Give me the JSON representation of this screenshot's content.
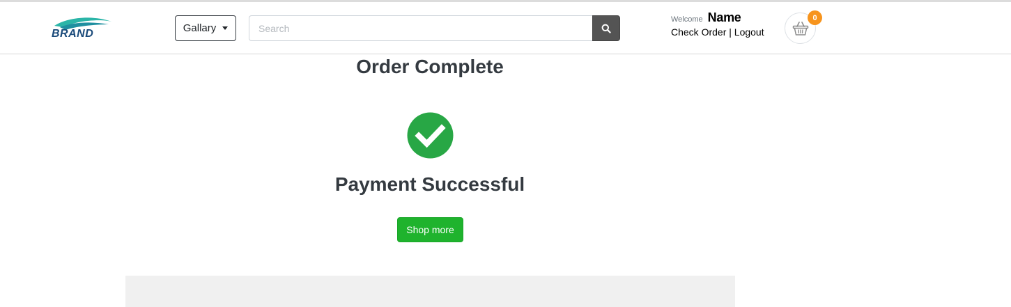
{
  "header": {
    "logo_text": "BRAND",
    "category_dropdown": "Gallary",
    "search": {
      "placeholder": "Search",
      "value": ""
    },
    "welcome_label": "Welcome",
    "user_name": "Name",
    "check_order_link": "Check Order",
    "separator": "|",
    "logout_link": "Logout",
    "cart_count": "0",
    "icons": [
      "search-icon",
      "basket-icon",
      "chevron-down-icon"
    ]
  },
  "main": {
    "title": "Order Complete",
    "status_icon": "check-circle-icon",
    "status_message": "Payment Successful",
    "shop_more_button": "Shop more"
  },
  "colors": {
    "success_green": "#28a745",
    "button_green": "#1fb32d",
    "badge_orange": "#f7941d",
    "brand_teal": "#2bb5a8",
    "brand_navy": "#1a4a7a",
    "search_button": "#545454"
  }
}
